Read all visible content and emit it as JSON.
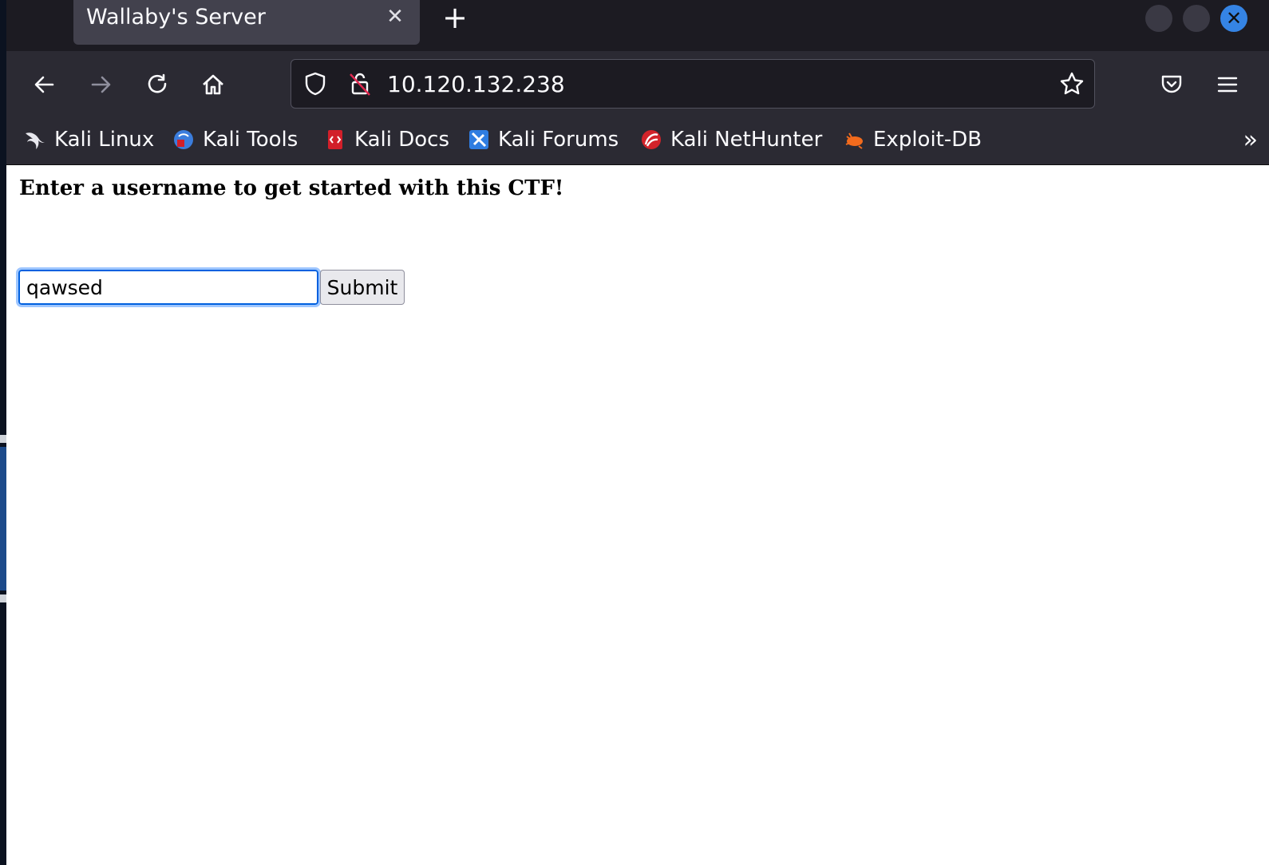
{
  "tab": {
    "title": "Wallaby's Server",
    "close_glyph": "✕",
    "new_tab_glyph": "+"
  },
  "window_controls": {
    "close_glyph": "✕"
  },
  "navigation": {
    "back_icon": "arrow-left-icon",
    "forward_icon": "arrow-right-icon",
    "reload_icon": "reload-icon",
    "home_icon": "home-icon"
  },
  "urlbar": {
    "url": "10.120.132.238",
    "shield_icon": "shield-icon",
    "insecure_lock_icon": "insecure-lock-icon",
    "bookmark_star_icon": "star-icon"
  },
  "toolbar_right": {
    "pocket_icon": "pocket-icon",
    "menu_icon": "hamburger-menu-icon"
  },
  "bookmarks": [
    {
      "label": "Kali Linux",
      "icon": "kali-dragon-icon",
      "color": "#000000"
    },
    {
      "label": "Kali Tools",
      "icon": "kali-tools-icon",
      "color": "#3b7ddd"
    },
    {
      "label": "Kali Docs",
      "icon": "kali-docs-icon",
      "color": "#d21f2a"
    },
    {
      "label": "Kali Forums",
      "icon": "kali-forums-icon",
      "color": "#2f7de1"
    },
    {
      "label": "Kali NetHunter",
      "icon": "kali-nethunter-icon",
      "color": "#d2232a"
    },
    {
      "label": "Exploit-DB",
      "icon": "exploit-db-icon",
      "color": "#f26b1d"
    }
  ],
  "bookmarks_overflow_glyph": "»",
  "page": {
    "heading": "Enter a username to get started with this CTF!",
    "username_value": "qawsed",
    "submit_label": "Submit"
  },
  "colors": {
    "tab_bar": "#1c1b22",
    "toolbar": "#2b2a33",
    "active_tab": "#42414d",
    "focus_ring": "#0060df"
  }
}
